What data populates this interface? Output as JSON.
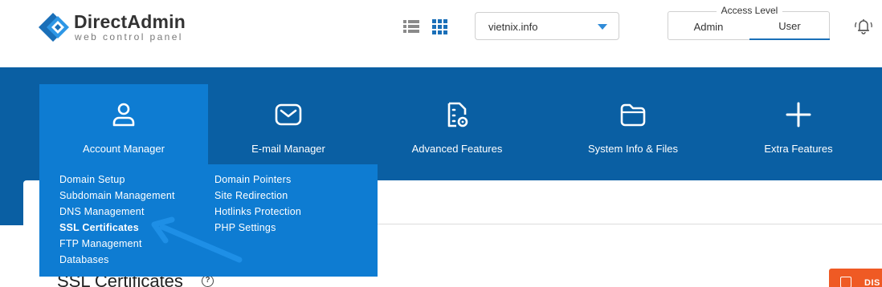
{
  "header": {
    "logo_name": "DirectAdmin",
    "logo_tagline": "web control panel",
    "domain_selected": "vietnix.info",
    "access_level": {
      "title": "Access Level",
      "options": [
        "Admin",
        "User"
      ],
      "active": "User"
    },
    "icons": [
      "list-view-icon",
      "grid-view-icon",
      "chevron-down-icon",
      "bell-icon"
    ]
  },
  "nav": {
    "items": [
      {
        "label": "Account Manager",
        "icon": "user-icon",
        "active": true
      },
      {
        "label": "E-mail Manager",
        "icon": "mail-icon"
      },
      {
        "label": "Advanced Features",
        "icon": "file-settings-icon"
      },
      {
        "label": "System Info & Files",
        "icon": "folder-icon"
      },
      {
        "label": "Extra Features",
        "icon": "plus-icon"
      }
    ]
  },
  "dropdown": {
    "col1": [
      "Domain Setup",
      "Subdomain Management",
      "DNS Management",
      "SSL Certificates",
      "FTP Management",
      "Databases"
    ],
    "col2": [
      "Domain Pointers",
      "Site Redirection",
      "Hotlinks Protection",
      "PHP Settings"
    ],
    "highlighted": "SSL Certificates"
  },
  "page": {
    "title": "SSL Certificates",
    "help_glyph": "?",
    "action_label": "DIS"
  },
  "colors": {
    "nav_bg": "#0a5fa3",
    "nav_active": "#0e7cd2",
    "accent": "#1a6fb8",
    "arrow": "#1e8fe6",
    "action": "#ef5a24"
  }
}
